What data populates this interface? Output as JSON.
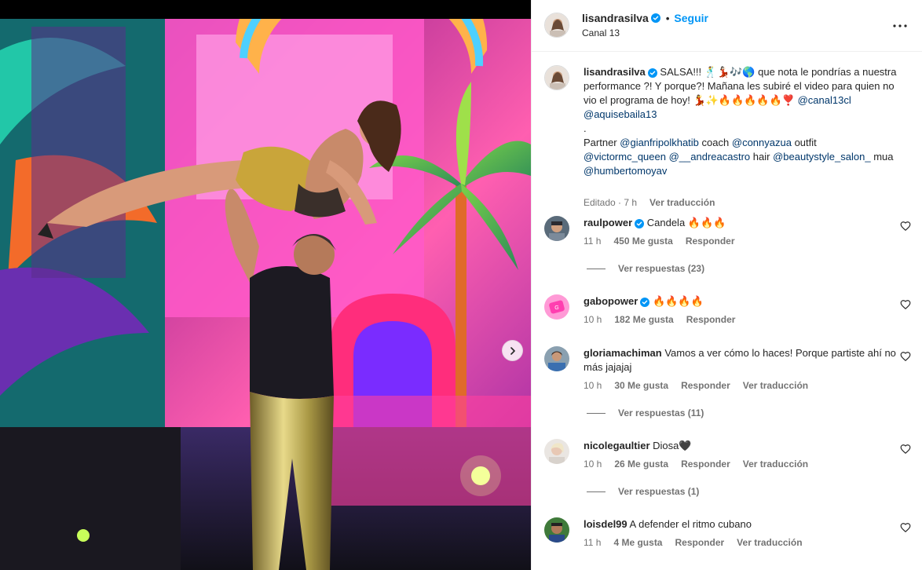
{
  "post": {
    "username": "lisandrasilva",
    "follow_label": "Seguir",
    "location": "Canal 13"
  },
  "caption": {
    "username": "lisandrasilva",
    "text1": "SALSA!!! 🕺💃🏻🎶🌎 que nota le pondrías a nuestra performance ?! Y porque?! Mañana les subiré el video para quien no vio el programa de hoy! 💃✨🔥🔥🔥🔥🔥❣️",
    "mention_canal": "@canal13cl",
    "mention_aquise": "@aquisebaila13",
    "dot": ".",
    "partner_label": "Partner",
    "partner": "@gianfripolkhatib",
    "coach_label": "coach",
    "coach": "@connyazua",
    "outfit_label": "outfit",
    "outfit": "@victormc_queen",
    "outfit2": "@__andreacastro",
    "hair_label": "hair",
    "hair": "@beautystyle_salon_",
    "mua_label": "mua",
    "mua": "@humbertomoyav",
    "edited": "Editado · 7 h",
    "translate": "Ver traducción"
  },
  "comments": [
    {
      "user": "raulpower",
      "verified": true,
      "text": "Candela 🔥🔥🔥",
      "time": "11 h",
      "likes": "450 Me gusta",
      "reply": "Responder",
      "replies": "Ver respuestas (23)"
    },
    {
      "user": "gabopower",
      "verified": true,
      "text": "🔥🔥🔥🔥",
      "time": "10 h",
      "likes": "182 Me gusta",
      "reply": "Responder"
    },
    {
      "user": "gloriamachiman",
      "verified": false,
      "text": "Vamos a ver cómo lo haces! Porque partiste ahí no más jajajaj",
      "time": "10 h",
      "likes": "30 Me gusta",
      "reply": "Responder",
      "translate": "Ver traducción",
      "replies": "Ver respuestas (11)"
    },
    {
      "user": "nicolegaultier",
      "verified": false,
      "text": "Diosa🖤",
      "time": "10 h",
      "likes": "26 Me gusta",
      "reply": "Responder",
      "translate": "Ver traducción",
      "replies": "Ver respuestas (1)"
    },
    {
      "user": "loisdel99",
      "verified": false,
      "text": "A defender el ritmo cubano",
      "time": "11 h",
      "likes": "4 Me gusta",
      "reply": "Responder",
      "translate": "Ver traducción"
    }
  ],
  "colors": {
    "accent": "#0095f6",
    "mention": "#00376b",
    "verified": "#0095f6",
    "muted": "#737373"
  },
  "icons": {
    "more": "more-horizontal-icon",
    "heart": "heart-outline-icon",
    "next": "chevron-right-icon",
    "verified": "verified-badge-icon"
  }
}
